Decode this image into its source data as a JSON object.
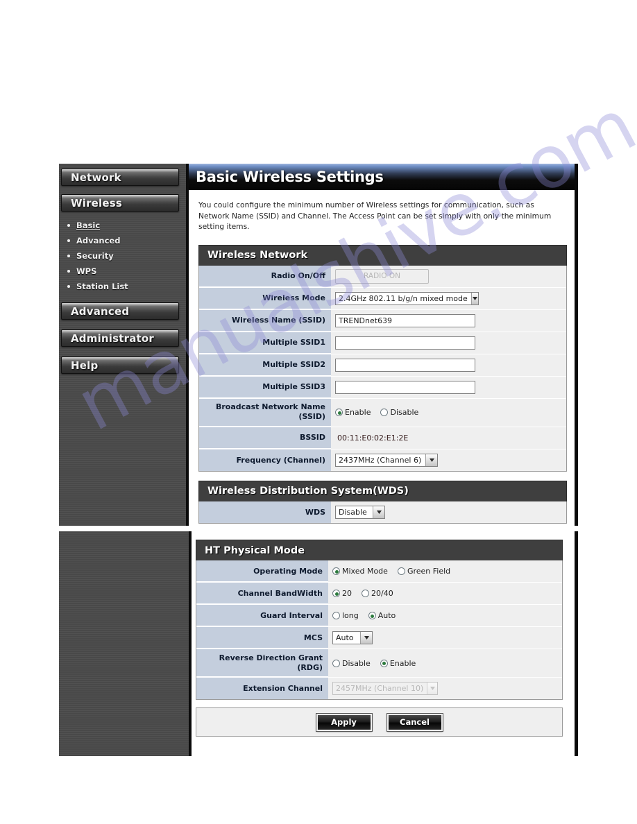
{
  "watermark": {
    "text": "manualshive.com"
  },
  "sidebar": {
    "menu": [
      {
        "label": "Network"
      },
      {
        "label": "Wireless"
      },
      {
        "label": "Advanced"
      },
      {
        "label": "Administrator"
      },
      {
        "label": "Help"
      }
    ],
    "wireless_submenu": [
      {
        "label": "Basic",
        "active": true
      },
      {
        "label": "Advanced",
        "active": false
      },
      {
        "label": "Security",
        "active": false
      },
      {
        "label": "WPS",
        "active": false
      },
      {
        "label": "Station List",
        "active": false
      }
    ]
  },
  "header": {
    "title": "Basic Wireless Settings"
  },
  "intro": "You could configure the minimum number of Wireless settings for communication, such as Network Name (SSID) and Channel. The Access Point can be set simply with only the minimum setting items.",
  "wireless_network": {
    "section_title": "Wireless Network",
    "radio_onoff_label": "Radio On/Off",
    "radio_onoff_button": "RADIO ON",
    "wireless_mode_label": "Wireless Mode",
    "wireless_mode_value": "2.4GHz 802.11 b/g/n mixed mode",
    "ssid_label": "Wireless Name (SSID)",
    "ssid_value": "TRENDnet639",
    "mssid1_label": "Multiple SSID1",
    "mssid1_value": "",
    "mssid2_label": "Multiple SSID2",
    "mssid2_value": "",
    "mssid3_label": "Multiple SSID3",
    "mssid3_value": "",
    "broadcast_label": "Broadcast Network Name (SSID)",
    "broadcast_enable": "Enable",
    "broadcast_disable": "Disable",
    "broadcast_selected": "Enable",
    "bssid_label": "BSSID",
    "bssid_value": "00:11:E0:02:E1:2E",
    "frequency_label": "Frequency (Channel)",
    "frequency_value": "2437MHz (Channel 6)"
  },
  "wds": {
    "section_title": "Wireless Distribution System(WDS)",
    "wds_label": "WDS",
    "wds_value": "Disable"
  },
  "ht_physical_mode": {
    "section_title": "HT Physical Mode",
    "operating_mode_label": "Operating Mode",
    "operating_mode_opt1": "Mixed Mode",
    "operating_mode_opt2": "Green Field",
    "operating_mode_selected": "Mixed Mode",
    "bandwidth_label": "Channel BandWidth",
    "bandwidth_opt1": "20",
    "bandwidth_opt2": "20/40",
    "bandwidth_selected": "20",
    "guard_label": "Guard Interval",
    "guard_opt1": "long",
    "guard_opt2": "Auto",
    "guard_selected": "Auto",
    "mcs_label": "MCS",
    "mcs_value": "Auto",
    "rdg_label": "Reverse Direction Grant (RDG)",
    "rdg_opt1": "Disable",
    "rdg_opt2": "Enable",
    "rdg_selected": "Enable",
    "ext_channel_label": "Extension Channel",
    "ext_channel_value": "2457MHz (Channel 10)"
  },
  "actions": {
    "apply": "Apply",
    "cancel": "Cancel"
  }
}
